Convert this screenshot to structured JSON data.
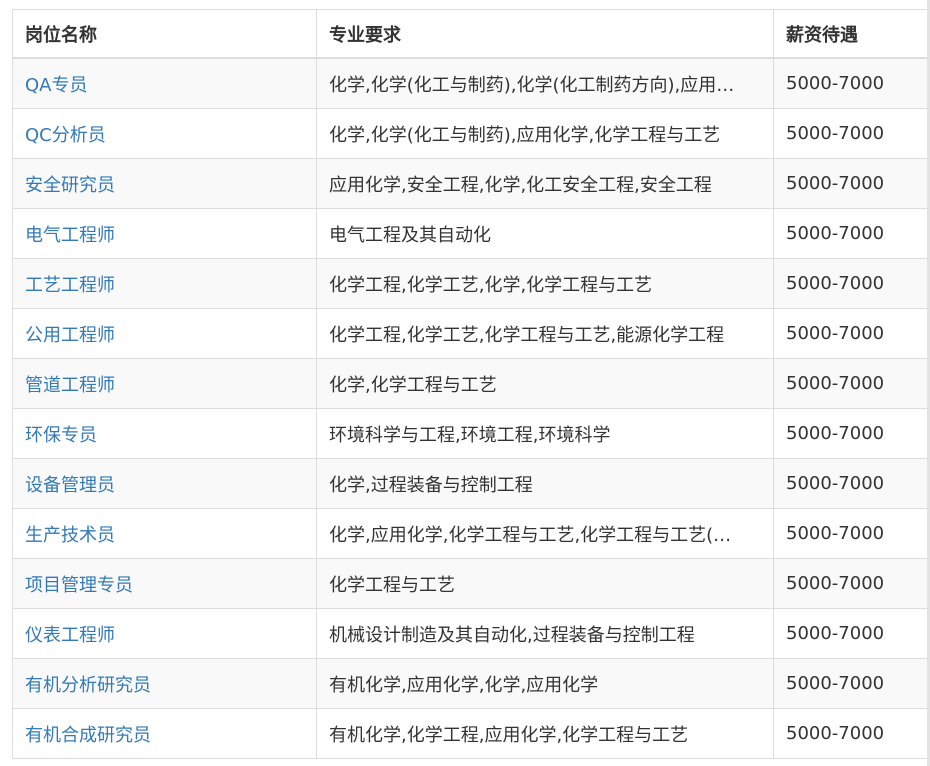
{
  "table": {
    "headers": [
      "岗位名称",
      "专业要求",
      "薪资待遇"
    ],
    "rows": [
      {
        "name": "QA专员",
        "major": "化学,化学(化工与制药),化学(化工制药方向),应用…",
        "salary": "5000-7000"
      },
      {
        "name": "QC分析员",
        "major": "化学,化学(化工与制药),应用化学,化学工程与工艺",
        "salary": "5000-7000"
      },
      {
        "name": "安全研究员",
        "major": "应用化学,安全工程,化学,化工安全工程,安全工程",
        "salary": "5000-7000"
      },
      {
        "name": "电气工程师",
        "major": "电气工程及其自动化",
        "salary": "5000-7000"
      },
      {
        "name": "工艺工程师",
        "major": "化学工程,化学工艺,化学,化学工程与工艺",
        "salary": "5000-7000"
      },
      {
        "name": "公用工程师",
        "major": "化学工程,化学工艺,化学工程与工艺,能源化学工程",
        "salary": "5000-7000"
      },
      {
        "name": "管道工程师",
        "major": "化学,化学工程与工艺",
        "salary": "5000-7000"
      },
      {
        "name": "环保专员",
        "major": "环境科学与工程,环境工程,环境科学",
        "salary": "5000-7000"
      },
      {
        "name": "设备管理员",
        "major": "化学,过程装备与控制工程",
        "salary": "5000-7000"
      },
      {
        "name": "生产技术员",
        "major": "化学,应用化学,化学工程与工艺,化学工程与工艺(…",
        "salary": "5000-7000"
      },
      {
        "name": "项目管理专员",
        "major": "化学工程与工艺",
        "salary": "5000-7000"
      },
      {
        "name": "仪表工程师",
        "major": "机械设计制造及其自动化,过程装备与控制工程",
        "salary": "5000-7000"
      },
      {
        "name": "有机分析研究员",
        "major": "有机化学,应用化学,化学,应用化学",
        "salary": "5000-7000"
      },
      {
        "name": "有机合成研究员",
        "major": "有机化学,化学工程,应用化学,化学工程与工艺",
        "salary": "5000-7000"
      }
    ]
  }
}
